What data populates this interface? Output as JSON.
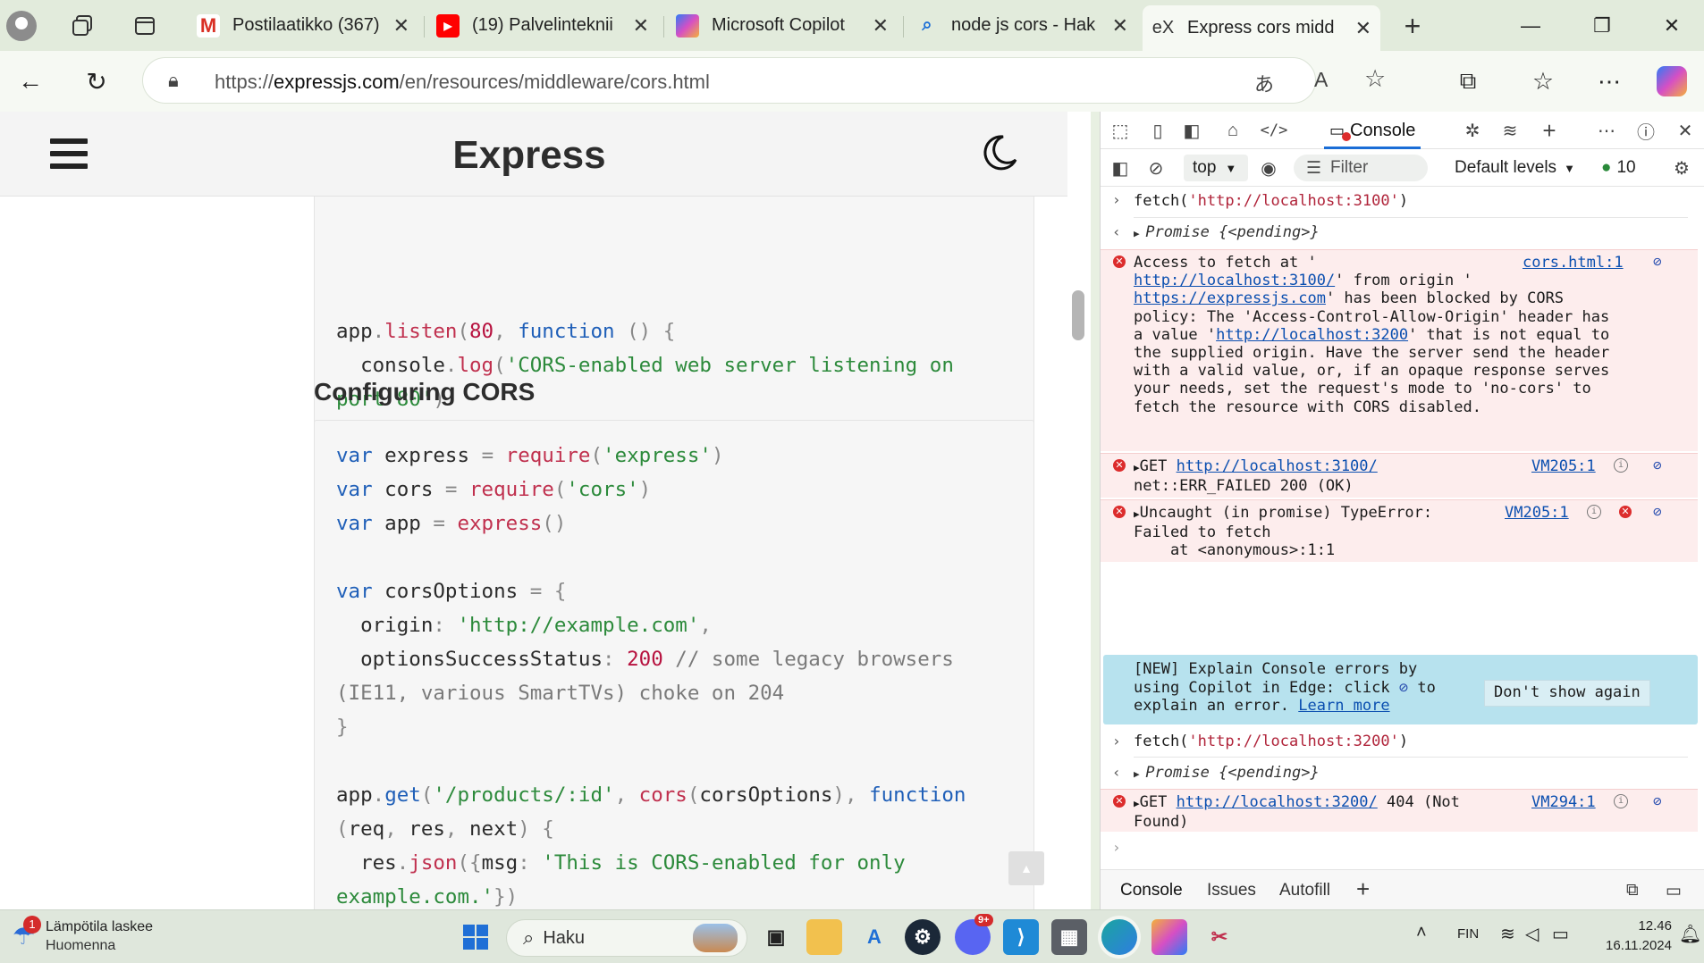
{
  "browser": {
    "tabs": [
      {
        "title": "Postilaatikko (367)",
        "favicon": "gmail-icon"
      },
      {
        "title": "(19) Palvelinteknii",
        "favicon": "youtube-icon"
      },
      {
        "title": "Microsoft Copilot",
        "favicon": "copilot-icon"
      },
      {
        "title": "node js cors - Hak",
        "favicon": "search-icon"
      },
      {
        "title": "Express cors midd",
        "favicon": "express-icon",
        "active": true
      }
    ],
    "url_prefix": "https://",
    "url_host": "expressjs.com",
    "url_path": "/en/resources/middleware/cors.html"
  },
  "page": {
    "site_title": "Express",
    "section_heading": "Configuring CORS",
    "code_block_1": [
      "app.listen(80, function () {",
      "  console.log('CORS-enabled web server listening on",
      "port 80')",
      "})"
    ],
    "code_block_2": [
      "var express = require('express')",
      "var cors = require('cors')",
      "var app = express()",
      "",
      "var corsOptions = {",
      "  origin: 'http://example.com',",
      "  optionsSuccessStatus: 200 // some legacy browsers",
      "(IE11, various SmartTVs) choke on 204",
      "}",
      "",
      "app.get('/products/:id', cors(corsOptions), function",
      "(req, res, next) {",
      "  res.json({msg: 'This is CORS-enabled for only",
      "example.com.'})"
    ]
  },
  "devtools": {
    "active_tab": "Console",
    "context": "top",
    "filter_placeholder": "Filter",
    "levels": "Default levels",
    "message_count": "10",
    "entries": {
      "input1": "fetch('http://localhost:3100')",
      "promise1": "Promise {<pending>}",
      "cors_error": {
        "lines": [
          "Access to fetch at '",
          "http://localhost:3100/",
          "' from origin '",
          "https://expressjs.com",
          "' has been blocked by CORS",
          "policy: The 'Access-Control-Allow-Origin' header has",
          "a value '",
          "http://localhost:3200",
          "' that is not equal to",
          "the supplied origin. Have the server send the header",
          "with a valid value, or, if an opaque response serves",
          "your needs, set the request's mode to 'no-cors' to",
          "fetch the resource with CORS disabled."
        ],
        "source": "cors.html:1"
      },
      "get1": {
        "method": "GET",
        "url": "http://localhost:3100/",
        "detail": "net::ERR_FAILED 200 (OK)",
        "source": "VM205:1"
      },
      "uncaught": {
        "line1": "Uncaught (in promise) TypeError:",
        "line2": "Failed to fetch",
        "line3": "    at <anonymous>:1:1",
        "source": "VM205:1"
      },
      "banner": {
        "line1": "[NEW] Explain Console errors by",
        "line2a": "using Copilot in Edge: click",
        "line2b": "to",
        "line3a": "explain an error.",
        "learn_more": "Learn more",
        "dont_show": "Don't show again"
      },
      "input2": "fetch('http://localhost:3200')",
      "promise2": "Promise {<pending>}",
      "get2": {
        "method": "GET",
        "url": "http://localhost:3200/",
        "detail_a": "404 (Not",
        "detail_b": "Found)",
        "source": "VM294:1"
      }
    },
    "drawer_tabs": [
      "Console",
      "Issues",
      "Autofill"
    ]
  },
  "taskbar": {
    "weather_line1": "Lämpötila laskee",
    "weather_line2": "Huomenna",
    "weather_badge": "1",
    "search_label": "Haku",
    "language": "FIN",
    "time": "12.46",
    "date": "16.11.2024",
    "chat_badge": "9+"
  },
  "colors": {
    "accent": "#1a6dd6",
    "error_bg": "#fdeded",
    "banner_bg": "#b7e2ee",
    "code_keyword": "#1f5fb8",
    "code_string": "#2c8a3b"
  }
}
